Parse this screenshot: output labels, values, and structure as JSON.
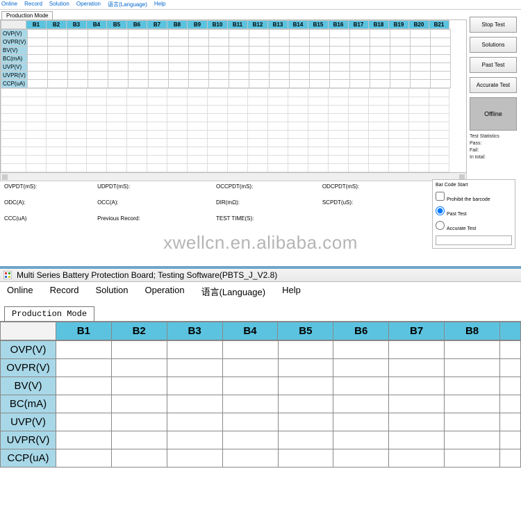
{
  "top": {
    "menu": [
      "Online",
      "Record",
      "Solution",
      "Operation",
      "语言(Language)",
      "Help"
    ],
    "tab": "Production Mode",
    "cols": [
      "B1",
      "B2",
      "B3",
      "B4",
      "B5",
      "B6",
      "B7",
      "B8",
      "B9",
      "B10",
      "B11",
      "B12",
      "B13",
      "B14",
      "B15",
      "B16",
      "B17",
      "B18",
      "B19",
      "B20",
      "B21"
    ],
    "rows": [
      "OVP(V)",
      "OVPR(V)",
      "BV(V)",
      "BC(mA)",
      "UVP(V)",
      "UVPR(V)",
      "CCP(uA)"
    ],
    "buttons": {
      "stop": "Stop Test",
      "solutions": "Solutions",
      "past": "Past Test",
      "accurate": "Accurate Test"
    },
    "offline": "Offline",
    "stats": {
      "title": "Test Statistics",
      "pass": "Pass:",
      "fail": "Fail:",
      "total": "In total:"
    },
    "props": {
      "ovpdt": "OVPDT(mS):",
      "udpdt": "UDPDT(mS):",
      "occpdt": "OCCPDT(mS):",
      "odcpdt": "ODCPDT(mS):",
      "odc": "ODC(A):",
      "occ": "OCC(A):",
      "dir": "DIR(mΩ):",
      "scpdt": "SCPDT(uS):",
      "ccc": "CCC(uA)",
      "prev": "Previous Record:",
      "testtime": "TEST TIME(S):"
    },
    "barcode": {
      "title": "Bar Code Start",
      "prohibit": "Prohibit the barcode",
      "past": "Past Test",
      "accurate": "Accurate Test"
    }
  },
  "watermark": "xwellcn.en.alibaba.com",
  "bottom": {
    "title": "Multi Series Battery Protection Board; Testing Software(PBTS_J_V2.8)",
    "menu": [
      "Online",
      "Record",
      "Solution",
      "Operation",
      "语言(Language)",
      "Help"
    ],
    "tab": "Production Mode",
    "cols": [
      "B1",
      "B2",
      "B3",
      "B4",
      "B5",
      "B6",
      "B7",
      "B8"
    ],
    "rows": [
      "OVP(V)",
      "OVPR(V)",
      "BV(V)",
      "BC(mA)",
      "UVP(V)",
      "UVPR(V)",
      "CCP(uA)"
    ]
  }
}
